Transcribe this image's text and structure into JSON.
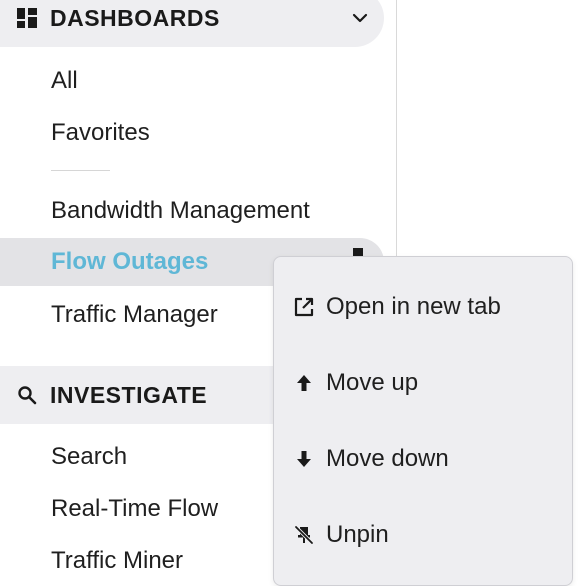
{
  "sidebar": {
    "dashboards": {
      "title": "DASHBOARDS",
      "icon": "grid-icon",
      "expand_icon": "chevron-down-icon",
      "items": [
        "All",
        "Favorites"
      ],
      "pinned": [
        "Bandwidth Management",
        "Flow Outages",
        "Traffic Manager"
      ],
      "active_item": "Flow Outages"
    },
    "investigate": {
      "title": "INVESTIGATE",
      "icon": "search-icon",
      "items": [
        "Search",
        "Real-Time Flow",
        "Traffic Miner"
      ]
    }
  },
  "context_menu": {
    "items": [
      {
        "label": "Open in new tab",
        "icon": "open-external-icon"
      },
      {
        "label": "Move up",
        "icon": "arrow-up-icon"
      },
      {
        "label": "Move down",
        "icon": "arrow-down-icon"
      },
      {
        "label": "Unpin",
        "icon": "unpin-icon"
      }
    ]
  },
  "colors": {
    "active_text": "#5fb7d6",
    "header_bg": "#eeeef1",
    "active_bg": "#e3e3e6"
  }
}
